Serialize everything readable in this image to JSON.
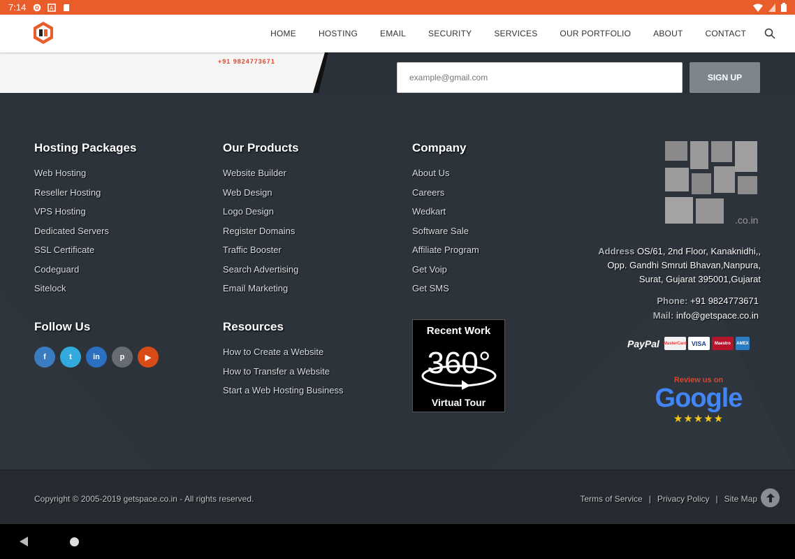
{
  "statusbar": {
    "time": "7:14"
  },
  "header": {
    "nav": [
      "HOME",
      "HOSTING",
      "EMAIL",
      "SECURITY",
      "SERVICES",
      "OUR PORTFOLIO",
      "ABOUT",
      "CONTACT"
    ]
  },
  "banner": {
    "phone": "+91 9824773671",
    "email_placeholder": "example@gmail.com",
    "signup_label": "SIGN UP"
  },
  "footer": {
    "hosting": {
      "title": "Hosting Packages",
      "items": [
        "Web Hosting",
        "Reseller Hosting",
        "VPS Hosting",
        "Dedicated Servers",
        "SSL Certificate",
        "Codeguard",
        "Sitelock"
      ]
    },
    "products": {
      "title": "Our Products",
      "items": [
        "Website Builder",
        "Web Design",
        "Logo Design",
        "Register Domains",
        "Traffic Booster",
        "Search Advertising",
        "Email Marketing"
      ]
    },
    "company": {
      "title": "Company",
      "items": [
        "About Us",
        "Careers",
        "Wedkart",
        "Software Sale",
        "Affiliate Program",
        "Get Voip",
        "Get SMS"
      ]
    },
    "follow": {
      "title": "Follow Us",
      "social": [
        "f",
        "t",
        "in",
        "p",
        "▶"
      ]
    },
    "resources": {
      "title": "Resources",
      "items": [
        "How to Create a Website",
        "How to Transfer a Website",
        "Start a Web Hosting Business"
      ]
    },
    "tour": {
      "line1": "Recent Work",
      "line2": "360°",
      "line3": "Virtual Tour"
    },
    "brand": {
      "domain": ".co.in"
    },
    "address": {
      "label": "Address",
      "line1": "OS/61, 2nd Floor, Kanaknidhi,,",
      "line2": "Opp. Gandhi Smruti Bhavan,Nanpura,",
      "line3": "Surat, Gujarat 395001,Gujarat"
    },
    "phone_label": "Phone:",
    "phone": "+91 9824773671",
    "mail_label": "Mail:",
    "mail": "info@getspace.co.in",
    "payments": {
      "paypal": "PayPal",
      "cards": [
        "MasterCard",
        "VISA",
        "Maestro",
        "AMEX"
      ]
    },
    "google": {
      "review": "Review us on",
      "brand": "Google",
      "stars": "★★★★★"
    }
  },
  "bottom": {
    "copyright": "Copyright © 2005-2019  getspace.co.in  - All rights reserved.",
    "links": [
      "Terms of Service",
      "Privacy Policy",
      "Site Map"
    ]
  },
  "colors": {
    "accent": "#e85d2a",
    "footer_bg": "#2c333b"
  }
}
